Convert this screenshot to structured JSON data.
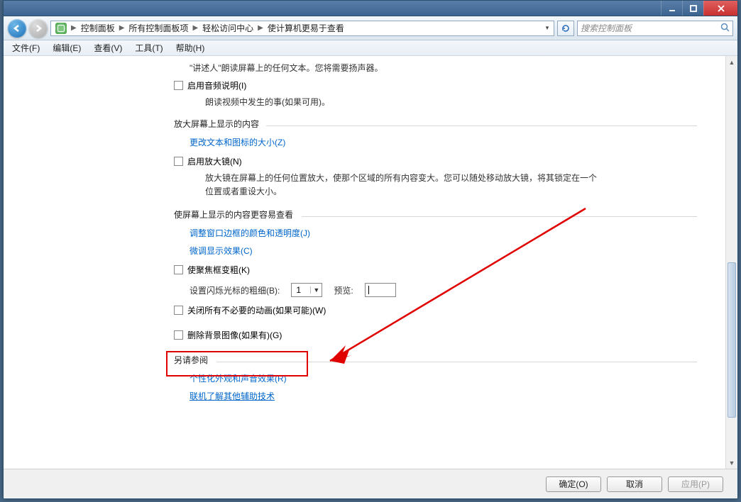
{
  "titlebar": {},
  "nav": {
    "breadcrumbs": [
      "控制面板",
      "所有控制面板项",
      "轻松访问中心",
      "使计算机更易于查看"
    ],
    "search_placeholder": "搜索控制面板"
  },
  "menu": {
    "file": "文件(F)",
    "edit": "编辑(E)",
    "view": "查看(V)",
    "tools": "工具(T)",
    "help": "帮助(H)"
  },
  "content": {
    "narrator_desc": "\"讲述人\"朗读屏幕上的任何文本。您将需要扬声器。",
    "audio_desc_chk": "启用音频说明(I)",
    "audio_desc_text": "朗读视频中发生的事(如果可用)。",
    "sec2_h": "放大屏幕上显示的内容",
    "sec2_link": "更改文本和图标的大小(Z)",
    "magnifier_chk": "启用放大镜(N)",
    "magnifier_desc": "放大镜在屏幕上的任何位置放大，使那个区域的所有内容变大。您可以随处移动放大镜，将其锁定在一个位置或者重设大小。",
    "sec3_h": "使屏幕上显示的内容更容易查看",
    "sec3_link1": "调整窗口边框的颜色和透明度(J)",
    "sec3_link2": "微调显示效果(C)",
    "focus_chk": "使聚焦框变粗(K)",
    "cursor_lbl": "设置闪烁光标的粗细(B):",
    "cursor_val": "1",
    "preview_lbl": "预览:",
    "anim_chk": "关闭所有不必要的动画(如果可能)(W)",
    "bg_chk": "删除背景图像(如果有)(G)",
    "sec4_h": "另请参阅",
    "sec4_link1": "个性化外观和声音效果(R)",
    "sec4_link2": "联机了解其他辅助技术"
  },
  "buttons": {
    "ok": "确定(O)",
    "cancel": "取消",
    "apply": "应用(P)"
  }
}
